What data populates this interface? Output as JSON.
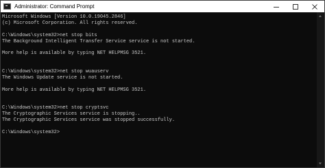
{
  "window": {
    "title": "Administrator: Command Prompt",
    "icon": "cmd-icon",
    "controls": [
      "minimize-icon",
      "maximize-icon",
      "close-icon"
    ]
  },
  "console": {
    "lines": [
      "Microsoft Windows [Version 10.0.19045.2846]",
      "(c) Microsoft Corporation. All rights reserved.",
      "",
      "C:\\Windows\\system32>net stop bits",
      "The Background Intelligent Transfer Service service is not started.",
      "",
      "More help is available by typing NET HELPMSG 3521.",
      "",
      "",
      "C:\\Windows\\system32>net stop wuauserv",
      "The Windows Update service is not started.",
      "",
      "More help is available by typing NET HELPMSG 3521.",
      "",
      "",
      "C:\\Windows\\system32>net stop cryptsvc",
      "The Cryptographic Services service is stopping..",
      "The Cryptographic Services service was stopped successfully.",
      "",
      "C:\\Windows\\system32>"
    ]
  },
  "colors": {
    "background": "#0c0c0c",
    "text": "#cccccc",
    "titlebar": "#ffffff"
  }
}
